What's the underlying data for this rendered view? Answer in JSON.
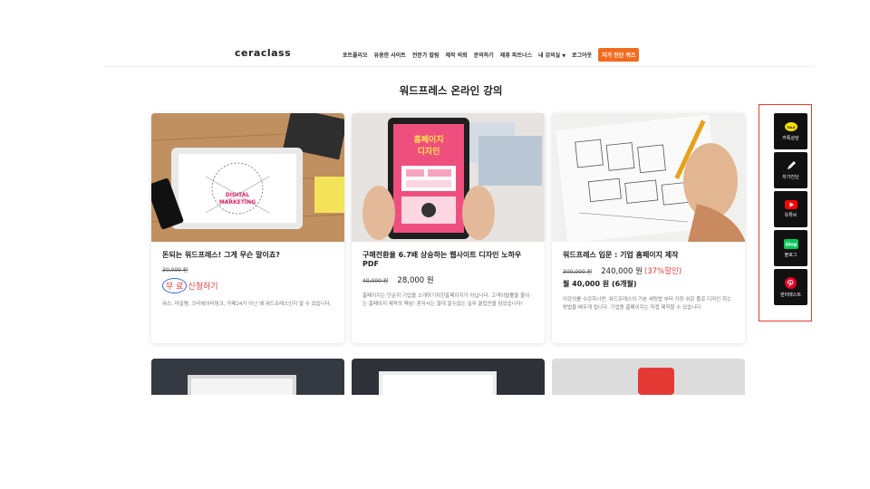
{
  "header": {
    "logo": "ceraclass",
    "nav": [
      {
        "label": "포트폴리오"
      },
      {
        "label": "유용한 사이트"
      },
      {
        "label": "전문가 칼럼"
      },
      {
        "label": "제작 의뢰"
      },
      {
        "label": "문의하기"
      },
      {
        "label": "제휴 파트너스"
      },
      {
        "label": "내 강의실"
      },
      {
        "label": "로그아웃"
      }
    ],
    "cta": "자가 진단 퀴즈"
  },
  "main": {
    "title": "워드프레스 온라인 강의",
    "cards": [
      {
        "title": "돈되는 워드프레스! 그게 무슨 말이죠?",
        "old_price": "30,000 원",
        "free_label": "무 료",
        "apply_label": "신청하기",
        "desc": "워스, 마일템, 크리에이터링크, 카페24가 아닌 왜 워드프레스인지 알 수 있습니다."
      },
      {
        "title": "구매전환율 6.7배 상승하는 웹사이트 디자인 노하우 PDF",
        "old_price": "40,000 원",
        "new_price": "28,000 원",
        "desc": "홈페이지는 단순히 기업을 소개하기위한홈페이지가 아닙니다. 고객이탈률을 줄이는 홈페이지 제작의 핵심! 혼자서는 절대 알수없는 실무 꿀팁만을 담았습니다!"
      },
      {
        "title": "워드프레스 입문 : 기업 홈페이지 제작",
        "old_price": "300,000 원",
        "new_price": "240,000 원",
        "discount": "(37%할인)",
        "monthly": "월 40,000 원 (6개월)",
        "desc": "이강의를 수강하시면, 워드프레스의 기본 세팅법 부터 가장 쉬운 플로 디자인 하는 방법을 배우게 됩니다. 기업용 홈페이지는 직접 제작할 수 있습니다"
      }
    ]
  },
  "image_text": {
    "digital": "DIGITAL",
    "marketing": "MARKETING",
    "homepage_1": "홈페이지",
    "homepage_2": "디자인"
  },
  "sidebar": {
    "items": [
      {
        "label": "카톡상담",
        "icon": "kakaotalk-icon",
        "badge": "TALK"
      },
      {
        "label": "자가진단",
        "icon": "pencil-icon"
      },
      {
        "label": "유튜브",
        "icon": "youtube-icon"
      },
      {
        "label": "블로그",
        "icon": "blog-icon",
        "badge": "blog"
      },
      {
        "label": "핀터레스트",
        "icon": "pinterest-icon"
      }
    ]
  },
  "colors": {
    "accent": "#f26b1d",
    "price_red": "#e23b3b",
    "highlight_box": "#e53935",
    "kakao_yellow": "#fae100",
    "naver_green": "#03c75a",
    "youtube_red": "#ff0000"
  }
}
